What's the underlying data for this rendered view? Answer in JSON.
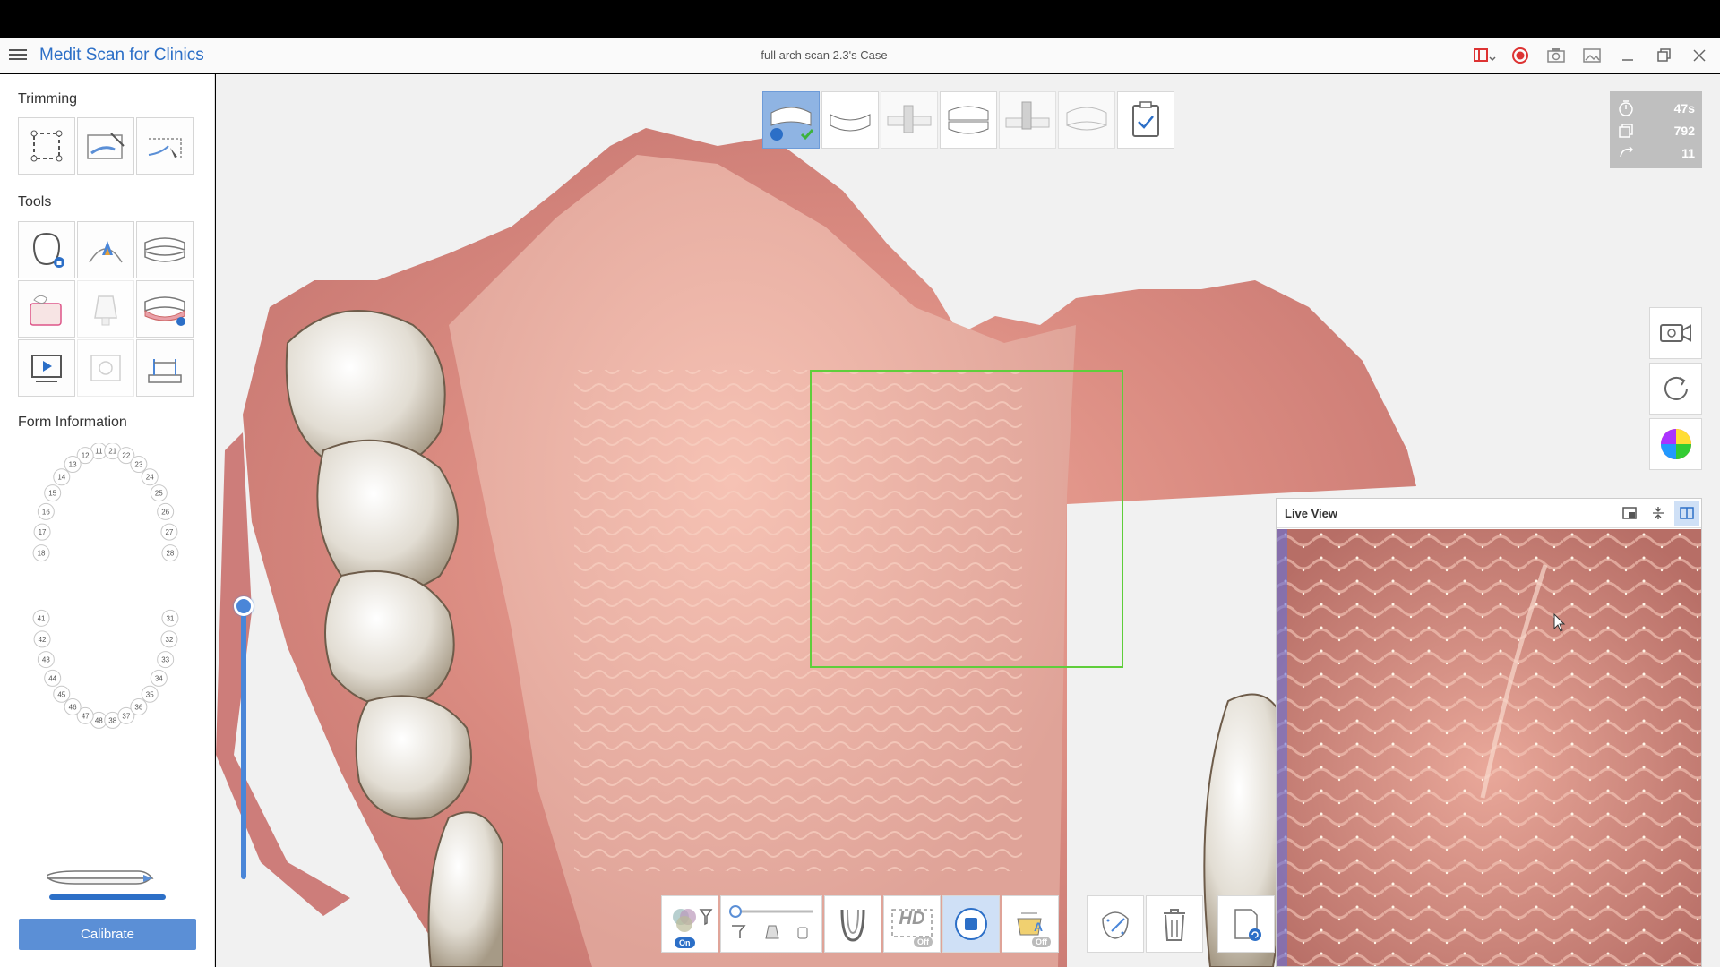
{
  "app": {
    "title": "Medit Scan for Clinics",
    "case_title": "full arch scan 2.3's Case"
  },
  "sidebar": {
    "trimming_title": "Trimming",
    "tools_title": "Tools",
    "form_title": "Form Information",
    "calibrate_label": "Calibrate",
    "trimming_tools": [
      "select-area-icon",
      "brush-trim-icon",
      "lasso-trim-icon"
    ],
    "tools": [
      "lock-tooth-icon",
      "margin-line-icon",
      "arch-icon",
      "smart-scope-icon",
      "abutment-icon",
      "gingiva-icon",
      "video-play-icon",
      "capture-icon",
      "ruler-icon"
    ]
  },
  "tooth_chart": {
    "upper_right": [
      "11",
      "12",
      "13",
      "14",
      "15",
      "16",
      "17",
      "18"
    ],
    "upper_left": [
      "21",
      "22",
      "23",
      "24",
      "25",
      "26",
      "27",
      "28"
    ],
    "lower_right": [
      "48",
      "47",
      "46",
      "45",
      "44",
      "43",
      "42",
      "41"
    ],
    "lower_left": [
      "38",
      "37",
      "36",
      "35",
      "34",
      "33",
      "32",
      "31"
    ]
  },
  "stats": {
    "time": "47s",
    "frames": "792",
    "count": "11"
  },
  "live_view": {
    "title": "Live View"
  },
  "toolbar": {
    "filter_on": "On",
    "hd_label": "HD",
    "hd_off": "Off",
    "ai_off": "Off"
  },
  "colors": {
    "accent": "#2c6fc7",
    "roi": "#5fce3b",
    "stage_active": "#8fb4e3"
  }
}
